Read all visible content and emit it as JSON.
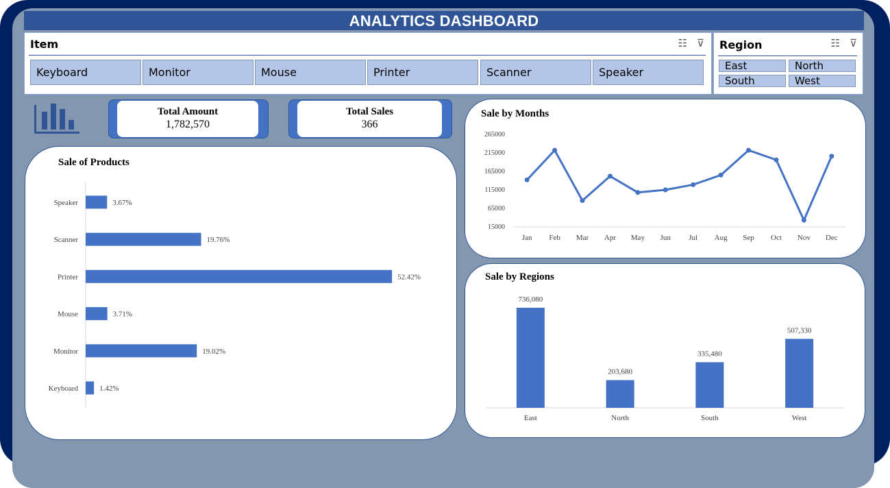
{
  "header": {
    "title": "ANALYTICS DASHBOARD"
  },
  "item_slicer": {
    "title": "Item",
    "options": [
      "Keyboard",
      "Monitor",
      "Mouse",
      "Printer",
      "Scanner",
      "Speaker"
    ]
  },
  "region_slicer": {
    "title": "Region",
    "options": [
      "East",
      "North",
      "South",
      "West"
    ]
  },
  "icons": {
    "multiselect": "multi-select-icon",
    "clear_filter": "clear-filter-icon",
    "dashboard_logo": "bar-chart-icon"
  },
  "colors": {
    "accent": "#4472c4",
    "header": "#2f5597",
    "frame": "#002060",
    "panel": "#8497b0",
    "slicer_button": "#b4c6e7"
  },
  "kpis": {
    "total_amount": {
      "label": "Total Amount",
      "value": "1,782,570"
    },
    "total_sales": {
      "label": "Total Sales",
      "value": "366"
    }
  },
  "chart_data": [
    {
      "type": "bar",
      "orientation": "horizontal",
      "title": "Sale of Products",
      "categories": [
        "Speaker",
        "Scanner",
        "Printer",
        "Mouse",
        "Monitor",
        "Keyboard"
      ],
      "values": [
        3.67,
        19.76,
        52.42,
        3.71,
        19.02,
        1.42
      ],
      "data_labels": [
        "3.67%",
        "19.76%",
        "52.42%",
        "3.71%",
        "19.02%",
        "1.42%"
      ],
      "xlim": [
        0,
        60
      ]
    },
    {
      "type": "line",
      "title": "Sale by Months",
      "categories": [
        "Jan",
        "Feb",
        "Mar",
        "Apr",
        "May",
        "Jun",
        "Jul",
        "Aug",
        "Sep",
        "Oct",
        "Nov",
        "Dec"
      ],
      "values": [
        142000,
        222000,
        86000,
        152000,
        108000,
        115000,
        129000,
        155000,
        222000,
        196000,
        33000,
        206000
      ],
      "yticks": [
        "265000",
        "215000",
        "165000",
        "115000",
        "65000",
        "15000"
      ],
      "ylim": [
        15000,
        265000
      ]
    },
    {
      "type": "bar",
      "title": "Sale by Regions",
      "categories": [
        "East",
        "North",
        "South",
        "West"
      ],
      "values": [
        736080,
        203680,
        335480,
        507330
      ],
      "data_labels": [
        "736,080",
        "203,680",
        "335,480",
        "507,330"
      ],
      "ylim": [
        0,
        800000
      ]
    }
  ]
}
